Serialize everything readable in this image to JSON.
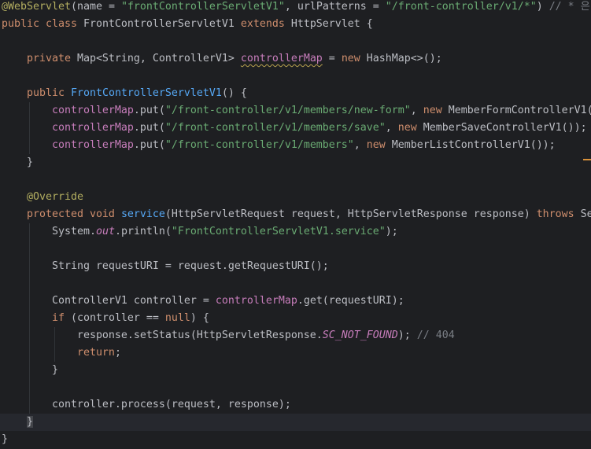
{
  "editor": {
    "theme": {
      "background": "#1e1f22",
      "current_line": "#26282e",
      "text": "#bcbec4",
      "keyword": "#cf8e6d",
      "annotation": "#b3ae60",
      "string": "#6aab73",
      "field": "#c77dbb",
      "method": "#56a8f5",
      "comment": "#7a7e85",
      "brace_match": "#43454a",
      "warning_underline": "#b8a24e",
      "indent_guide": "#313438",
      "marker": "#d9913a"
    },
    "lines": [
      {
        "tokens": [
          {
            "t": "@WebServlet",
            "k": "ann"
          },
          {
            "t": "(name = ",
            "k": "plain"
          },
          {
            "t": "\"frontControllerServletV1\"",
            "k": "str"
          },
          {
            "t": ", urlPatterns = ",
            "k": "plain"
          },
          {
            "t": "\"/front-controller/v1/*\"",
            "k": "str"
          },
          {
            "t": ") ",
            "k": "plain"
          },
          {
            "t": "// * 은",
            "k": "comment"
          }
        ]
      },
      {
        "tokens": [
          {
            "t": "public class ",
            "k": "kw"
          },
          {
            "t": "FrontControllerServletV1 ",
            "k": "plain"
          },
          {
            "t": "extends ",
            "k": "kw"
          },
          {
            "t": "HttpServlet {",
            "k": "plain"
          }
        ]
      },
      {
        "tokens": []
      },
      {
        "tokens": [
          {
            "t": "    ",
            "k": "plain"
          },
          {
            "t": "private ",
            "k": "kw"
          },
          {
            "t": "Map<String, ControllerV1> ",
            "k": "plain"
          },
          {
            "t": "controllerMap",
            "k": "field-warn"
          },
          {
            "t": " = ",
            "k": "plain"
          },
          {
            "t": "new ",
            "k": "kw"
          },
          {
            "t": "HashMap<>();",
            "k": "plain"
          }
        ]
      },
      {
        "tokens": []
      },
      {
        "tokens": [
          {
            "t": "    ",
            "k": "plain"
          },
          {
            "t": "public ",
            "k": "kw"
          },
          {
            "t": "FrontControllerServletV1",
            "k": "method"
          },
          {
            "t": "() {",
            "k": "plain"
          }
        ]
      },
      {
        "tokens": [
          {
            "t": "        ",
            "k": "plain"
          },
          {
            "t": "controllerMap",
            "k": "field"
          },
          {
            "t": ".put(",
            "k": "plain"
          },
          {
            "t": "\"/front-controller/v1/members/new-form\"",
            "k": "str"
          },
          {
            "t": ", ",
            "k": "plain"
          },
          {
            "t": "new ",
            "k": "kw"
          },
          {
            "t": "MemberFormControllerV1(",
            "k": "plain"
          }
        ]
      },
      {
        "tokens": [
          {
            "t": "        ",
            "k": "plain"
          },
          {
            "t": "controllerMap",
            "k": "field"
          },
          {
            "t": ".put(",
            "k": "plain"
          },
          {
            "t": "\"/front-controller/v1/members/save\"",
            "k": "str"
          },
          {
            "t": ", ",
            "k": "plain"
          },
          {
            "t": "new ",
            "k": "kw"
          },
          {
            "t": "MemberSaveControllerV1());",
            "k": "plain"
          }
        ]
      },
      {
        "tokens": [
          {
            "t": "        ",
            "k": "plain"
          },
          {
            "t": "controllerMap",
            "k": "field"
          },
          {
            "t": ".put(",
            "k": "plain"
          },
          {
            "t": "\"/front-controller/v1/members\"",
            "k": "str"
          },
          {
            "t": ", ",
            "k": "plain"
          },
          {
            "t": "new ",
            "k": "kw"
          },
          {
            "t": "MemberListControllerV1());",
            "k": "plain"
          }
        ]
      },
      {
        "tokens": [
          {
            "t": "    }",
            "k": "plain"
          }
        ]
      },
      {
        "tokens": []
      },
      {
        "tokens": [
          {
            "t": "    ",
            "k": "plain"
          },
          {
            "t": "@Override",
            "k": "ann"
          }
        ]
      },
      {
        "tokens": [
          {
            "t": "    ",
            "k": "plain"
          },
          {
            "t": "protected void ",
            "k": "kw"
          },
          {
            "t": "service",
            "k": "method"
          },
          {
            "t": "(HttpServletRequest request, HttpServletResponse response) ",
            "k": "plain"
          },
          {
            "t": "throws ",
            "k": "kw"
          },
          {
            "t": "Se",
            "k": "plain"
          }
        ]
      },
      {
        "tokens": [
          {
            "t": "        System.",
            "k": "plain"
          },
          {
            "t": "out",
            "k": "static"
          },
          {
            "t": ".println(",
            "k": "plain"
          },
          {
            "t": "\"FrontControllerServletV1.service\"",
            "k": "str"
          },
          {
            "t": ");",
            "k": "plain"
          }
        ]
      },
      {
        "tokens": []
      },
      {
        "tokens": [
          {
            "t": "        String requestURI = request.getRequestURI();",
            "k": "plain"
          }
        ]
      },
      {
        "tokens": []
      },
      {
        "tokens": [
          {
            "t": "        ControllerV1 controller = ",
            "k": "plain"
          },
          {
            "t": "controllerMap",
            "k": "field"
          },
          {
            "t": ".get(requestURI);",
            "k": "plain"
          }
        ]
      },
      {
        "tokens": [
          {
            "t": "        ",
            "k": "plain"
          },
          {
            "t": "if ",
            "k": "kw"
          },
          {
            "t": "(controller == ",
            "k": "plain"
          },
          {
            "t": "null",
            "k": "kw"
          },
          {
            "t": ") {",
            "k": "plain"
          }
        ]
      },
      {
        "tokens": [
          {
            "t": "            response.setStatus(HttpServletResponse.",
            "k": "plain"
          },
          {
            "t": "SC_NOT_FOUND",
            "k": "static"
          },
          {
            "t": "); ",
            "k": "plain"
          },
          {
            "t": "// 404",
            "k": "comment"
          }
        ]
      },
      {
        "tokens": [
          {
            "t": "            ",
            "k": "plain"
          },
          {
            "t": "return",
            "k": "kw"
          },
          {
            "t": ";",
            "k": "plain"
          }
        ]
      },
      {
        "tokens": [
          {
            "t": "        }",
            "k": "plain"
          }
        ]
      },
      {
        "tokens": []
      },
      {
        "tokens": [
          {
            "t": "        controller.process(request, response);",
            "k": "plain"
          }
        ]
      },
      {
        "current": true,
        "tokens": [
          {
            "t": "    ",
            "k": "plain"
          },
          {
            "t": "}",
            "k": "brace"
          }
        ]
      },
      {
        "tokens": [
          {
            "t": "}",
            "k": "plain"
          }
        ]
      }
    ]
  }
}
